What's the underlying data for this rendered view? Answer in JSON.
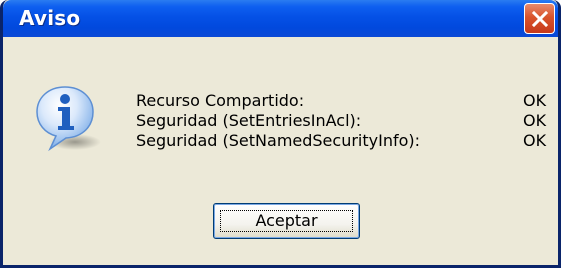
{
  "window": {
    "title": "Aviso"
  },
  "icon": {
    "name": "info-icon",
    "glyph": "i"
  },
  "messages": [
    {
      "label": "Recurso Compartido:",
      "status": "OK"
    },
    {
      "label": "Seguridad (SetEntriesInAcl):",
      "status": "OK"
    },
    {
      "label": "Seguridad (SetNamedSecurityInfo):",
      "status": "OK"
    }
  ],
  "buttons": {
    "accept_label": "Aceptar",
    "close_icon": "close-icon"
  },
  "colors": {
    "titlebar": "#0551e6",
    "close_button": "#d9542c",
    "window_body": "#ece9d8",
    "info_icon": "#2f78d8"
  }
}
